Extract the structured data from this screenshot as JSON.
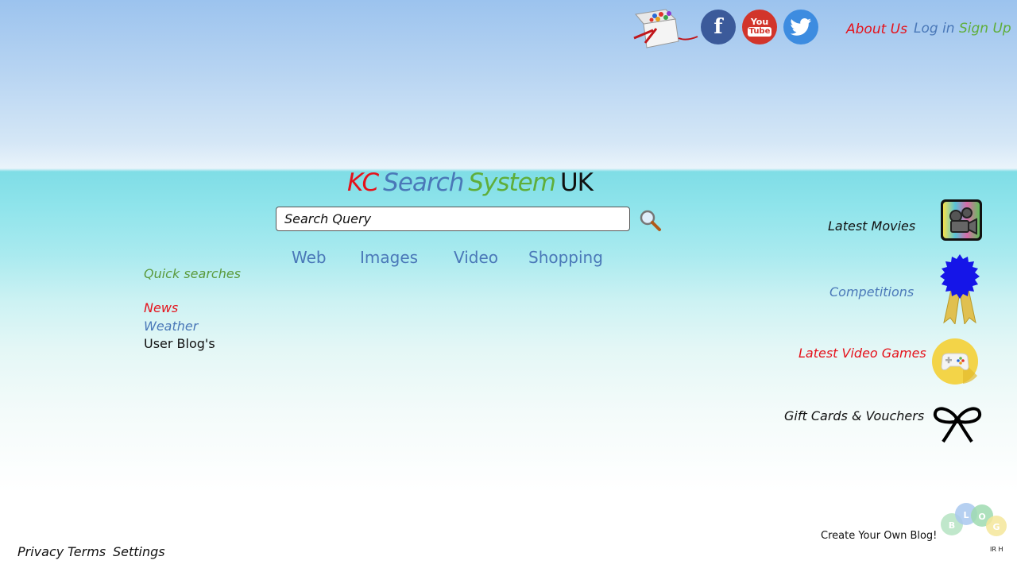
{
  "header": {
    "nav": {
      "about": "About Us",
      "login": "Log in",
      "signup": "Sign Up"
    },
    "social": {
      "facebook_glyph": "f",
      "youtube_you": "You",
      "youtube_tube": "Tube"
    }
  },
  "logo": {
    "kc": "KC",
    "search": "Search",
    "system": "System",
    "uk": "UK"
  },
  "search": {
    "placeholder": "Search Query"
  },
  "tabs": [
    "Web",
    "Images",
    "Video",
    "Shopping"
  ],
  "quick": {
    "heading": "Quick searches",
    "links": [
      "News",
      "Weather",
      "User Blog's"
    ]
  },
  "right": {
    "movies": "Latest Movies",
    "competitions": "Competitions",
    "games": "Latest Video Games",
    "gifts": "Gift Cards & Vouchers"
  },
  "blog": {
    "label": "Create Your Own Blog!",
    "initials": "IR H",
    "letters": [
      "B",
      "L",
      "O",
      "G"
    ]
  },
  "footer": {
    "privacy": "Privacy",
    "terms": "Terms",
    "settings": "Settings"
  },
  "colors": {
    "red": "#e5121b",
    "blue": "#4a78b8",
    "green": "#5fae3a",
    "black": "#111111"
  }
}
